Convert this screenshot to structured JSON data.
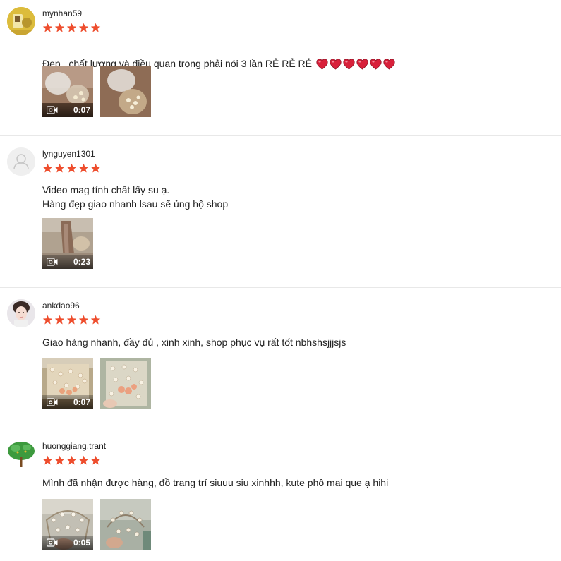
{
  "colors": {
    "star": "#ee4d2d",
    "heart": "#d8203a",
    "divider": "#e8e8e8"
  },
  "reviews": [
    {
      "username": "mynhan59",
      "rating": 5,
      "comment": "Đẹp , chất lượng và điều quan trọng phải nói 3 lần  RẺ RẺ RẺ",
      "hearts": 6,
      "media": [
        {
          "type": "video",
          "duration": "0:07"
        },
        {
          "type": "image"
        }
      ]
    },
    {
      "username": "lynguyen1301",
      "rating": 5,
      "comment": "Video mag tính chất lấy su ạ.\nHàng đẹp giao nhanh lsau sẽ ủng hộ shop",
      "media": [
        {
          "type": "video",
          "duration": "0:23"
        }
      ]
    },
    {
      "username": "ankdao96",
      "rating": 5,
      "comment": "Giao hàng nhanh, đầy đủ , xinh xinh, shop phục vụ rất tốt nbhshsjjjsjs",
      "media": [
        {
          "type": "video",
          "duration": "0:07"
        },
        {
          "type": "image"
        }
      ]
    },
    {
      "username": "huonggiang.trant",
      "rating": 5,
      "comment": "Mình đã nhận được hàng, đồ trang trí siuuu siu xinhhh, kute phô mai que ạ hihi",
      "media": [
        {
          "type": "video",
          "duration": "0:05"
        },
        {
          "type": "image"
        }
      ]
    }
  ]
}
